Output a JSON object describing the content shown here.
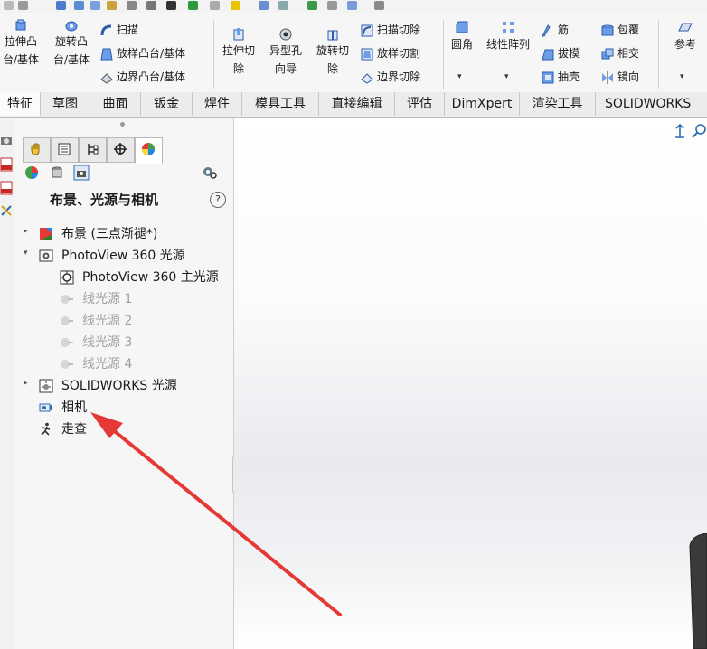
{
  "ribbon": {
    "extrude_boss": "拉伸凸\n台/基体",
    "revolve_boss": "旋转凸\n台/基体",
    "sweep": "扫描",
    "loft_boss": "放样凸台/基体",
    "boundary_boss": "边界凸台/基体",
    "extrude_cut": "拉伸切\n除",
    "hole_wizard": "异型孔\n向导",
    "revolve_cut": "旋转切\n除",
    "swept_cut": "扫描切除",
    "lofted_cut": "放样切割",
    "boundary_cut": "边界切除",
    "fillet": "圆角",
    "linear_pattern": "线性阵列",
    "rib": "筋",
    "draft": "拔模",
    "shell": "抽壳",
    "wrap": "包覆",
    "intersect": "相交",
    "mirror": "镜向",
    "reference": "参考"
  },
  "tabs": [
    "特征",
    "草图",
    "曲面",
    "钣金",
    "焊件",
    "模具工具",
    "直接编辑",
    "评估",
    "DimXpert",
    "渲染工具",
    "SOLIDWORKS 插"
  ],
  "active_tab": "特征",
  "panel": {
    "title": "布景、光源与相机",
    "help": "?",
    "tree": {
      "scene": "布景 (三点渐褪*)",
      "photoview": "PhotoView 360 光源",
      "pv_main": "PhotoView 360 主光源",
      "line1": "线光源 1",
      "line2": "线光源 2",
      "line3": "线光源 3",
      "line4": "线光源 4",
      "sw_lights": "SOLIDWORKS 光源",
      "camera": "相机",
      "walkthrough": "走查"
    }
  },
  "colors": {
    "accent_blue": "#2b6cb0",
    "arrow_red": "#e53935",
    "dim_text": "#a0a0a0"
  }
}
